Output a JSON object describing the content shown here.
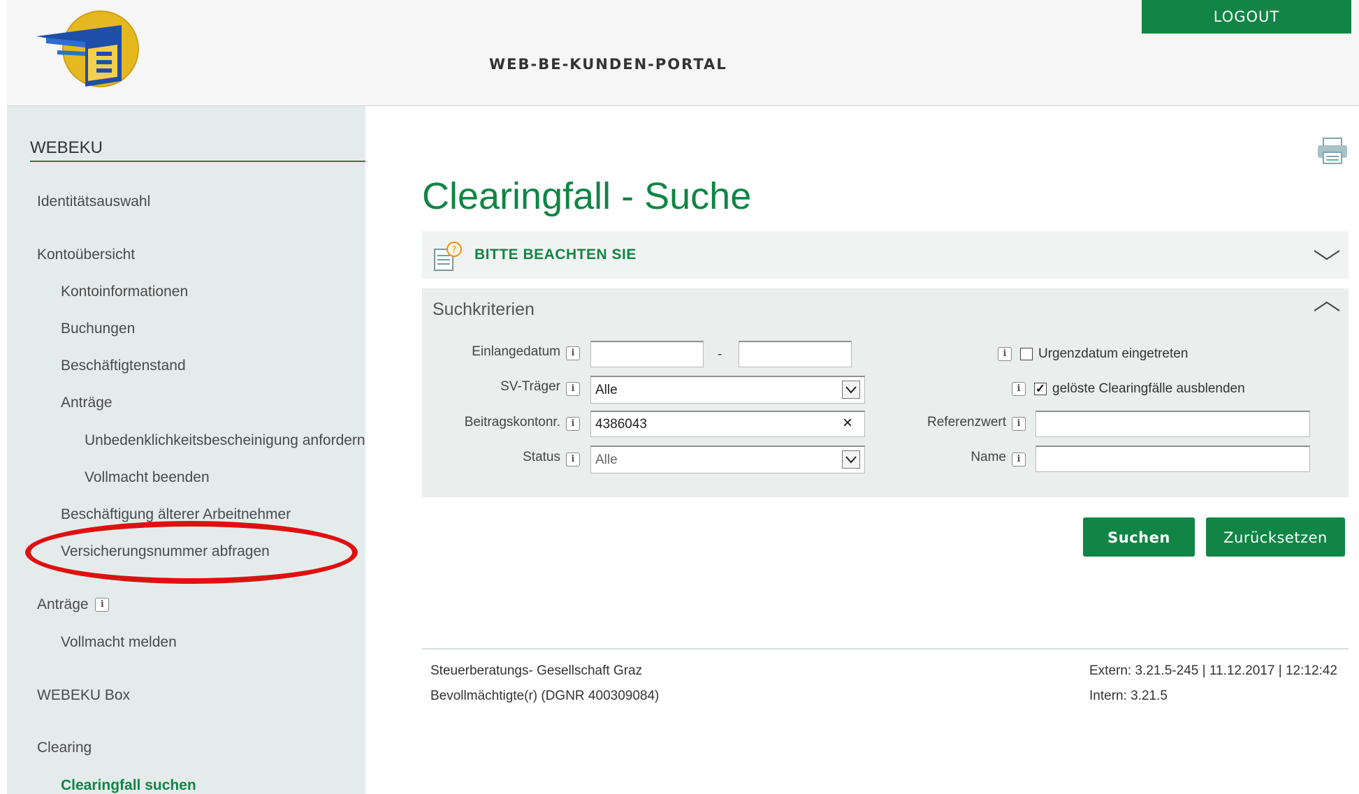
{
  "header": {
    "portal_title": "WEB-BE-KUNDEN-PORTAL",
    "logout_label": "LOGOUT"
  },
  "sidebar": {
    "heading": "WEBEKU",
    "items": [
      "Identitätsauswahl",
      "Kontoübersicht",
      "Kontoinformationen",
      "Buchungen",
      "Beschäftigtenstand",
      "Anträge",
      "Unbedenklichkeitsbescheinigung anfordern",
      "Vollmacht beenden",
      "Beschäftigung älterer Arbeitnehmer",
      "Versicherungsnummer abfragen",
      "Anträge",
      "Vollmacht melden",
      "WEBEKU Box",
      "Clearing",
      "Clearingfall suchen"
    ],
    "info_icon": "i"
  },
  "main": {
    "title": "Clearingfall - Suche",
    "notice_label": "BITTE BEACHTEN SIE",
    "panel_title": "Suchkriterien",
    "fields": {
      "einlangedatum_label": "Einlangedatum",
      "date_separator": "-",
      "svtraeger_label": "SV-Träger",
      "svtraeger_value": "Alle",
      "beitragskonto_label": "Beitragskontonr.",
      "beitragskonto_value": "4386043",
      "status_label": "Status",
      "status_value": "Alle",
      "urgenz_label": "Urgenzdatum eingetreten",
      "urgenz_checked": false,
      "geloeste_label": "gelöste Clearingfälle ausblenden",
      "geloeste_checked": true,
      "referenzwert_label": "Referenzwert",
      "name_label": "Name"
    },
    "buttons": {
      "search": "Suchen",
      "reset": "Zurücksetzen"
    },
    "clear_glyph": "×",
    "check_glyph": "✓"
  },
  "footer": {
    "company": "Steuerberatungs- Gesellschaft Graz",
    "role": "Bevollmächtigte(r) (DGNR 400309084)",
    "extern": "Extern: 3.21.5-245 | 11.12.2017 | 12:12:42",
    "intern": "Intern: 3.21.5"
  },
  "colors": {
    "brand_green": "#108545",
    "annotation_red": "#e01010"
  },
  "icons": [
    "app-logo",
    "print-icon",
    "notice-help-icon",
    "chevron-down-icon",
    "chevron-up-icon",
    "info-icon",
    "clear-icon",
    "dropdown-arrow-icon",
    "checkbox"
  ]
}
